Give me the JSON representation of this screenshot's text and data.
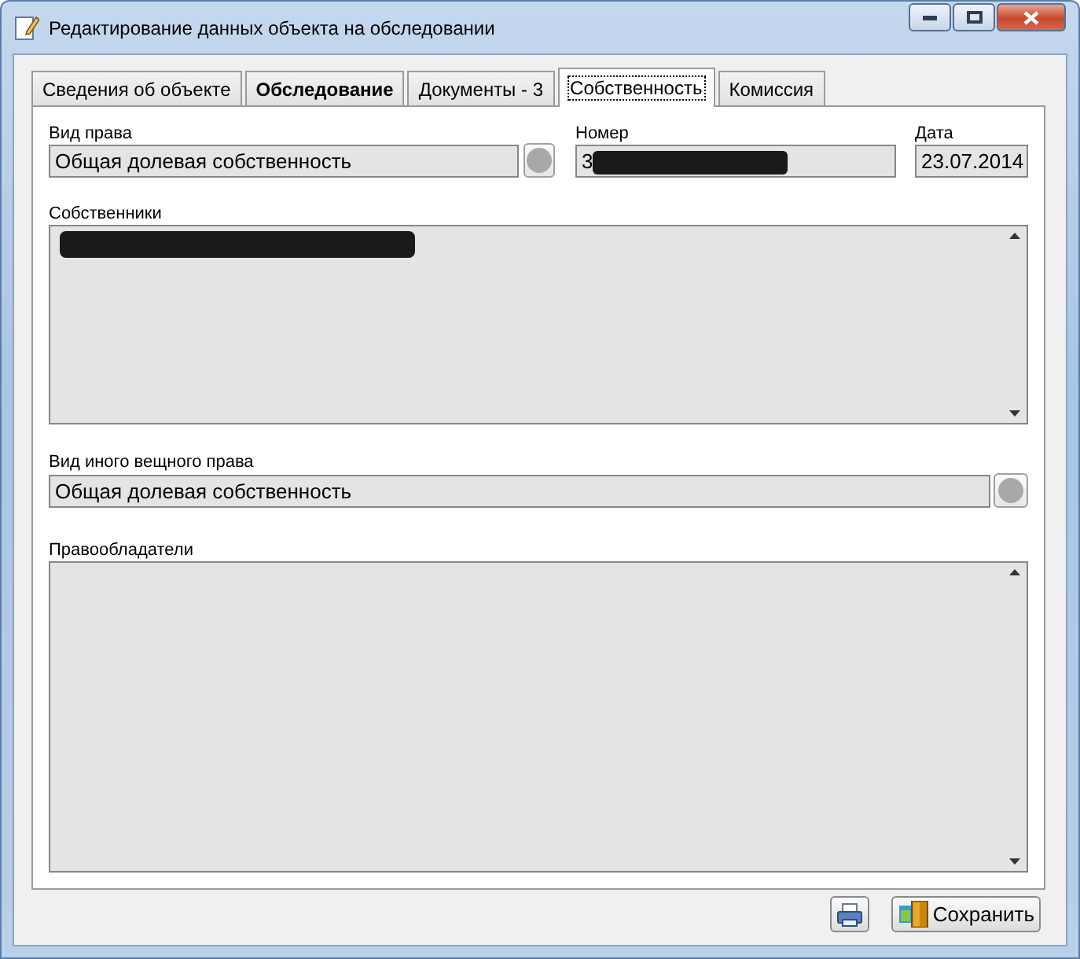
{
  "window": {
    "title": "Редактирование данных объекта на обследовании"
  },
  "tabs": [
    {
      "label": "Сведения об объекте",
      "selected": false,
      "bold": false
    },
    {
      "label": "Обследование",
      "selected": false,
      "bold": true
    },
    {
      "label": "Документы - 3",
      "selected": false,
      "bold": false
    },
    {
      "label": "Собственность",
      "selected": true,
      "bold": false
    },
    {
      "label": "Комиссия",
      "selected": false,
      "bold": false
    }
  ],
  "right_type": {
    "label": "Вид права",
    "value": "Общая долевая собственность"
  },
  "number": {
    "label": "Номер",
    "value": "3",
    "redacted": true
  },
  "date": {
    "label": "Дата",
    "value": "23.07.2014"
  },
  "owners": {
    "label": "Собственники",
    "redacted": true
  },
  "other_right_type": {
    "label": "Вид иного вещного права",
    "value": "Общая долевая собственность"
  },
  "right_holders": {
    "label": "Правообладатели"
  },
  "buttons": {
    "save": "Сохранить"
  }
}
